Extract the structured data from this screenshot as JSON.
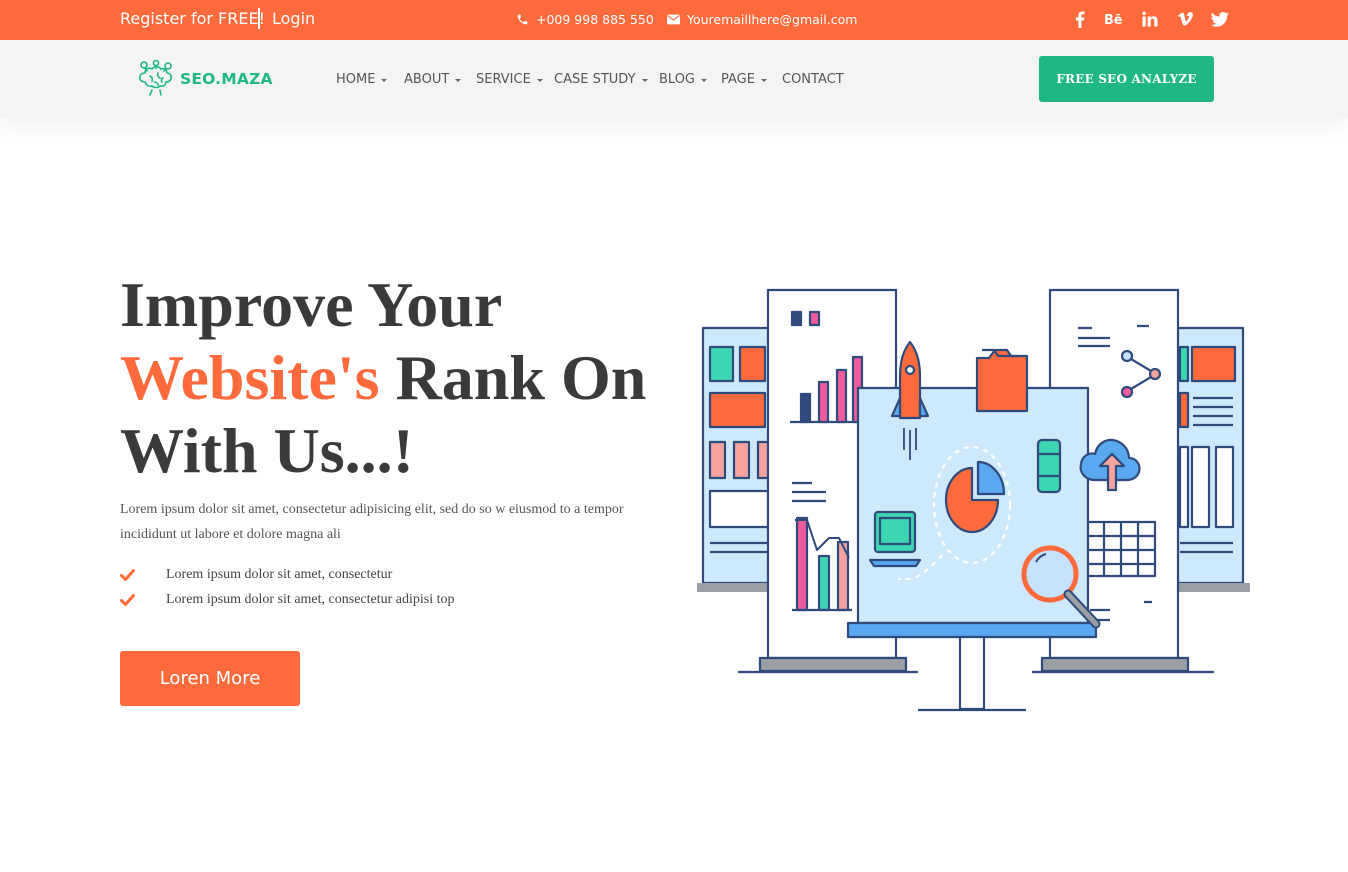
{
  "topbar": {
    "register": "Register for FREE!",
    "login": "Login",
    "phone": "+009 998 885 550",
    "email": "Youremaillhere@gmail.com",
    "socials": [
      "facebook-icon",
      "behance-icon",
      "linkedin-icon",
      "vimeo-icon",
      "twitter-icon"
    ]
  },
  "nav": {
    "logo_text": "SEO.MAZA",
    "items": [
      {
        "label": "HOME",
        "dropdown": true
      },
      {
        "label": "ABOUT",
        "dropdown": true
      },
      {
        "label": "SERVICE",
        "dropdown": true
      },
      {
        "label": "CASE STUDY",
        "dropdown": true
      },
      {
        "label": "BLOG",
        "dropdown": true
      },
      {
        "label": "PAGE",
        "dropdown": true
      },
      {
        "label": "CONTACT",
        "dropdown": false
      }
    ],
    "cta": "FREE SEO ANALYZE"
  },
  "hero": {
    "title_line1": "Improve Your",
    "title_accent": "Website's",
    "title_line2_rest": " Rank On",
    "title_line3": "With Us...!",
    "description": "Lorem ipsum dolor sit amet, consectetur adipisicing elit, sed do so w eiusmod to a tempor incididunt ut labore et dolore magna ali",
    "bullets": [
      "Lorem ipsum dolor sit amet, consectetur",
      "Lorem ipsum dolor sit amet, consectetur adipisi top"
    ],
    "button": "Loren More"
  },
  "colors": {
    "primary": "#ff6a3d",
    "secondary": "#1fb882",
    "heading": "#3a3a3a",
    "nav_bg": "#f3f4f3",
    "illustration_stroke": "#2f4a7c",
    "illustration_fill": "#cde9fb"
  }
}
